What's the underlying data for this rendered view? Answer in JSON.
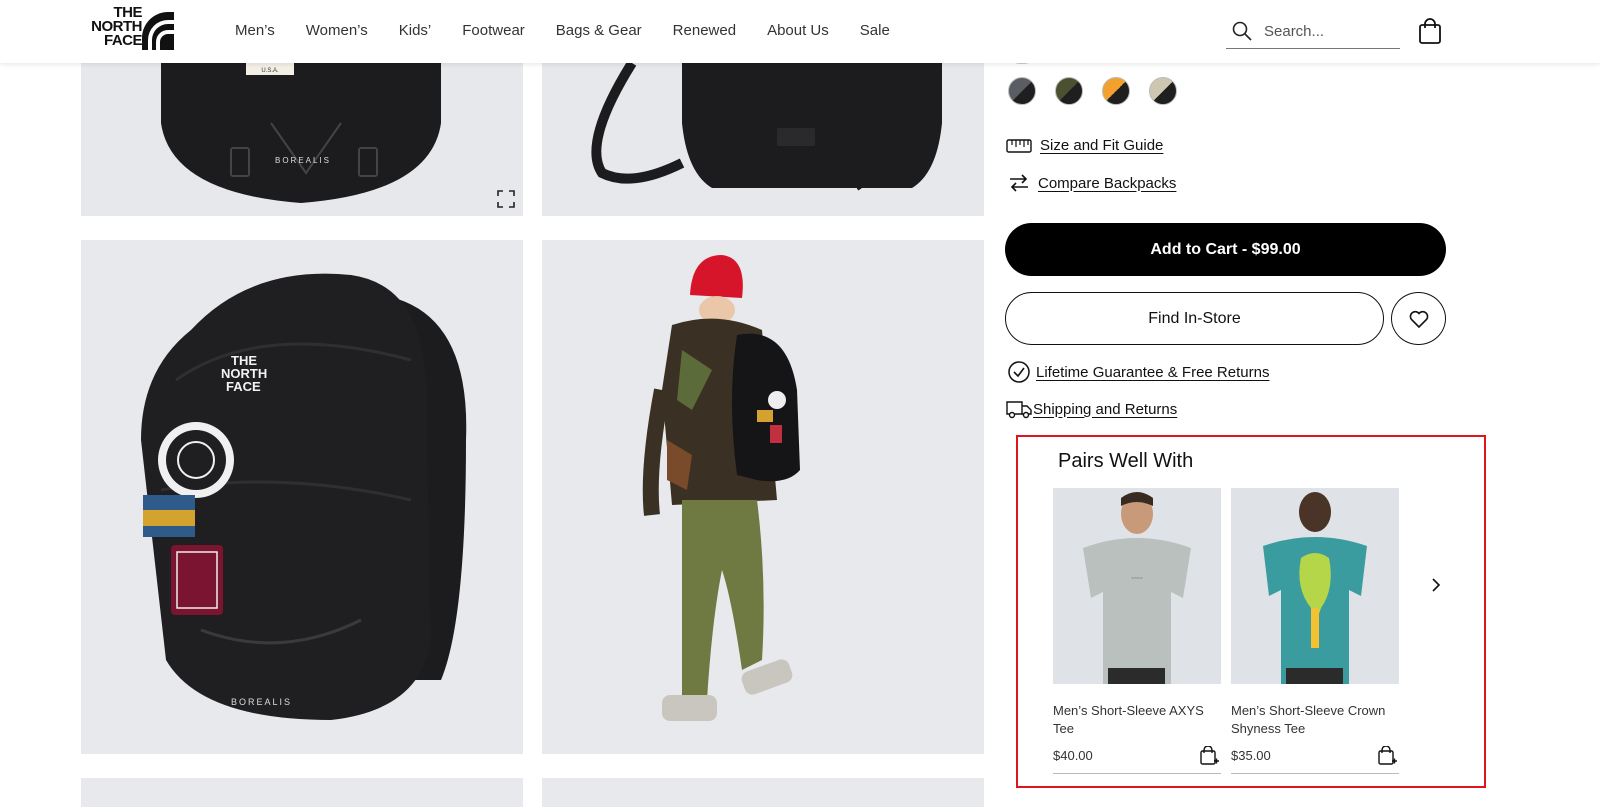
{
  "header": {
    "logo": {
      "line1": "THE",
      "line2": "NORTH",
      "line3": "FACE"
    },
    "nav": [
      "Men’s",
      "Women’s",
      "Kids’",
      "Footwear",
      "Bags & Gear",
      "Renewed",
      "About Us",
      "Sale"
    ],
    "search_placeholder": "Search...",
    "icons": {
      "search": "search-icon",
      "cart": "shopping-bag-icon"
    }
  },
  "product": {
    "swatches": [
      {
        "name": "swatch-1",
        "a": "#1f1f1f",
        "b": "#5a5d62"
      },
      {
        "name": "swatch-2",
        "a": "#1f1f1f",
        "b": "#4b5130"
      },
      {
        "name": "swatch-3",
        "a": "#1f1f1f",
        "b": "#f2a12e"
      },
      {
        "name": "swatch-4",
        "a": "#1f1f1f",
        "b": "#cfc6b2"
      }
    ],
    "size_guide": "Size and Fit Guide",
    "compare": "Compare Backpacks",
    "add_to_cart": "Add to Cart - $99.00",
    "find_store": "Find In-Store",
    "guarantee": "Lifetime Guarantee & Free Returns",
    "shipping": "Shipping and Returns"
  },
  "pairs": {
    "title": "Pairs Well With",
    "items": [
      {
        "name": "Men’s Short-Sleeve AXYS Tee",
        "price": "$40.00",
        "shirt_color": "#b9c0bd"
      },
      {
        "name": "Men’s Short-Sleeve Crown Shyness Tee",
        "price": "$35.00",
        "shirt_color": "#3a9c9e"
      }
    ]
  },
  "colors": {
    "accent_highlight": "#e0141b",
    "button": "#000000"
  }
}
